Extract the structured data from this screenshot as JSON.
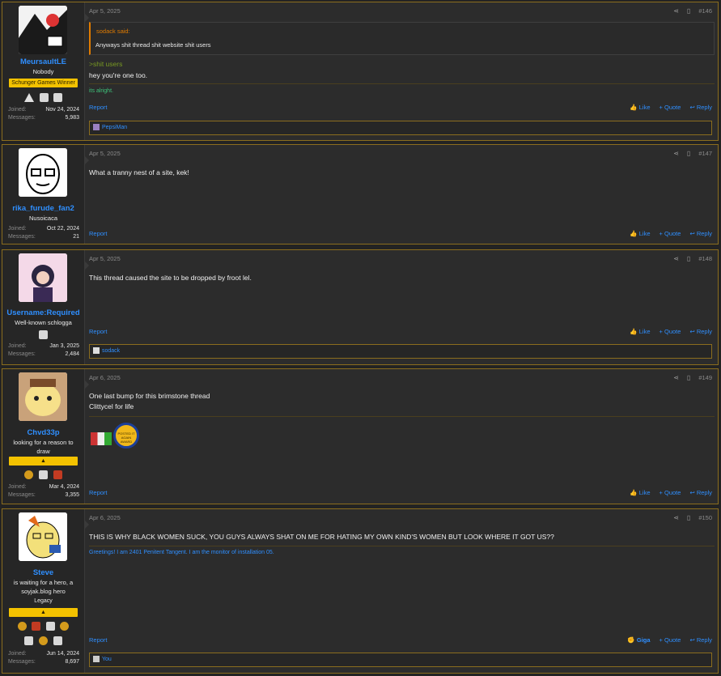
{
  "posts": [
    {
      "user": {
        "name": "MeursaultLE",
        "title": "Nobody",
        "banner": "Schunger Games Winner",
        "joined_label": "Joined:",
        "joined": "Nov 24, 2024",
        "messages_label": "Messages:",
        "messages": "5,983"
      },
      "date": "Apr 5, 2025",
      "number": "#146",
      "quote": {
        "author": "sodack said:",
        "text": "Anyways shit thread shit website shit users"
      },
      "greentext": ">shit users",
      "text": "hey you're one too.",
      "signature": "its alright.",
      "actions": {
        "report": "Report",
        "like": "Like",
        "quote": "Quote",
        "reply": "Reply"
      },
      "reactions": "PepsiMan"
    },
    {
      "user": {
        "name": "rika_furude_fan2",
        "title": "Nusoicaca",
        "joined_label": "Joined:",
        "joined": "Oct 22, 2024",
        "messages_label": "Messages:",
        "messages": "21"
      },
      "date": "Apr 5, 2025",
      "number": "#147",
      "text": "What a tranny nest of a site, kek!",
      "actions": {
        "report": "Report",
        "like": "Like",
        "quote": "Quote",
        "reply": "Reply"
      }
    },
    {
      "user": {
        "name": "Username:Required",
        "title": "Well-known schlogga",
        "joined_label": "Joined:",
        "joined": "Jan 3, 2025",
        "messages_label": "Messages:",
        "messages": "2,484"
      },
      "date": "Apr 5, 2025",
      "number": "#148",
      "text": "This thread caused the site to be dropped by froot lel.",
      "actions": {
        "report": "Report",
        "like": "Like",
        "quote": "Quote",
        "reply": "Reply"
      },
      "reactions": "sodack"
    },
    {
      "user": {
        "name": "Chvd33p",
        "title": "looking for a reason to draw",
        "joined_label": "Joined:",
        "joined": "Mar 4, 2024",
        "messages_label": "Messages:",
        "messages": "3,355"
      },
      "date": "Apr 6, 2025",
      "number": "#149",
      "text_line1": "One last bump for this brimstone thread",
      "text_line2": "Clittycel for life",
      "award": "POSTED IT AGAIN AWARD",
      "actions": {
        "report": "Report",
        "like": "Like",
        "quote": "Quote",
        "reply": "Reply"
      }
    },
    {
      "user": {
        "name": "Steve",
        "title": "is waiting for a hero, a soyjak.blog hero",
        "subtitle": "Legacy",
        "joined_label": "Joined:",
        "joined": "Jun 14, 2024",
        "messages_label": "Messages:",
        "messages": "8,697"
      },
      "date": "Apr 6, 2025",
      "number": "#150",
      "text": "THIS IS WHY BLACK WOMEN SUCK, YOU GUYS ALWAYS SHAT ON ME FOR HATING MY OWN KIND'S WOMEN BUT LOOK WHERE IT GOT US??",
      "signature": "Greetings! I am 2401 Penitent Tangent. I am the monitor of installation 05.",
      "actions": {
        "report": "Report",
        "giga": "Giga",
        "quote": "Quote",
        "reply": "Reply"
      },
      "reactions": "You"
    }
  ]
}
